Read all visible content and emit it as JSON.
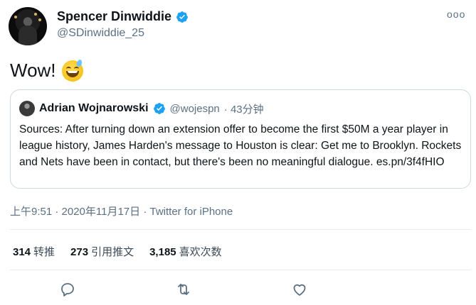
{
  "author": {
    "display_name": "Spencer Dinwiddie",
    "handle": "@SDinwiddie_25",
    "verified": true
  },
  "more_menu": "ooo",
  "tweet": {
    "text": "Wow!",
    "emoji_icon": "grinning-face-with-sweat-icon"
  },
  "quoted_tweet": {
    "display_name": "Adrian Wojnarowski",
    "handle": "@wojespn",
    "time_ago": "· 43分钟",
    "text": "Sources: After turning down an extension offer to become the first $50M a year player in league history, James Harden's message to Houston is clear: Get me to Brooklyn. Rockets and Nets have been in contact, but there's been no meaningful dialogue. es.pn/3f4fHIO"
  },
  "timestamp": "上午9:51 · 2020年11月17日 · Twitter for iPhone",
  "stats": {
    "retweets_count": "314",
    "retweets_label": "转推",
    "quotes_count": "273",
    "quotes_label": "引用推文",
    "likes_count": "3,185",
    "likes_label": "喜欢次数"
  },
  "actions": [
    "reply-icon",
    "retweet-icon",
    "like-icon"
  ],
  "colors": {
    "verified_blue": "#1da1f2",
    "secondary_text": "#5b7083",
    "border": "#cfd9de"
  }
}
